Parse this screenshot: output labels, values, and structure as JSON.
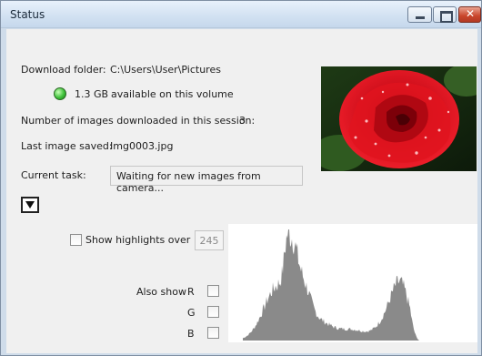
{
  "window": {
    "title": "Status"
  },
  "download": {
    "folder_label": "Download folder:",
    "folder_path": "C:\\Users\\User\\Pictures",
    "space_text": "1.3 GB",
    "space_suffix": "available on this volume"
  },
  "session": {
    "images_label": "Number of images downloaded in this session:",
    "images_count": "3",
    "last_saved_label": "Last image saved:",
    "last_saved_value": "Img0003.jpg"
  },
  "task": {
    "label": "Current task:",
    "value": "Waiting for new images from camera..."
  },
  "highlights": {
    "label": "Show highlights over",
    "threshold": "245",
    "also_show": "Also show",
    "channels": [
      "R",
      "G",
      "B"
    ],
    "checked": false
  },
  "histogram": {
    "color": "#8a8a8a",
    "description_free": true
  },
  "photo": {
    "subject_icon": "rose-photo"
  }
}
